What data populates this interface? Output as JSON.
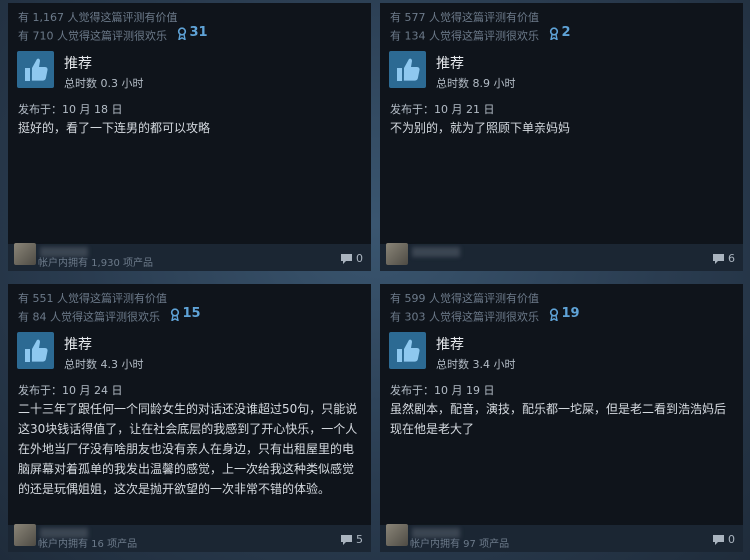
{
  "colors": {
    "accent": "#5fa3d7",
    "thumb_bg": "#2c6a93"
  },
  "reviews": [
    {
      "helpful": "有 1,167 人觉得这篇评测有价值",
      "funny": "有 710 人觉得这篇评测很欢乐",
      "awards": "31",
      "recommend": "推荐",
      "hours": "总时数 0.3 小时",
      "posted": "发布于：10 月 18 日",
      "text": "挺好的，看了一下连男的都可以攻略",
      "products": "帐户内拥有 1,930 项产品",
      "comments": "0"
    },
    {
      "helpful": "有 577 人觉得这篇评测有价值",
      "funny": "有 134 人觉得这篇评测很欢乐",
      "awards": "2",
      "recommend": "推荐",
      "hours": "总时数 8.9 小时",
      "posted": "发布于：10 月 21 日",
      "text": "不为别的，就为了照顾下单亲妈妈",
      "products": "",
      "comments": "6"
    },
    {
      "helpful": "有 551 人觉得这篇评测有价值",
      "funny": "有 84 人觉得这篇评测很欢乐",
      "awards": "15",
      "recommend": "推荐",
      "hours": "总时数 4.3 小时",
      "posted": "发布于：10 月 24 日",
      "text": "二十三年了跟任何一个同龄女生的对话还没谁超过50句，只能说这30块钱话得值了，让在社会底层的我感到了开心快乐，一个人在外地当厂仔没有啥朋友也没有亲人在身边，只有出租屋里的电脑屏幕对着孤单的我发出温馨的感觉，上一次给我这种类似感觉的还是玩偶姐姐，这次是抛开欲望的一次非常不错的体验。",
      "products": "帐户内拥有 16 项产品",
      "comments": "5"
    },
    {
      "helpful": "有 599 人觉得这篇评测有价值",
      "funny": "有 303 人觉得这篇评测很欢乐",
      "awards": "19",
      "recommend": "推荐",
      "hours": "总时数 3.4 小时",
      "posted": "发布于：10 月 19 日",
      "text": "虽然剧本，配音，演技，配乐都一坨屎，但是老二看到浩浩妈后现在他是老大了",
      "products": "帐户内拥有 97 项产品",
      "comments": "0"
    }
  ]
}
